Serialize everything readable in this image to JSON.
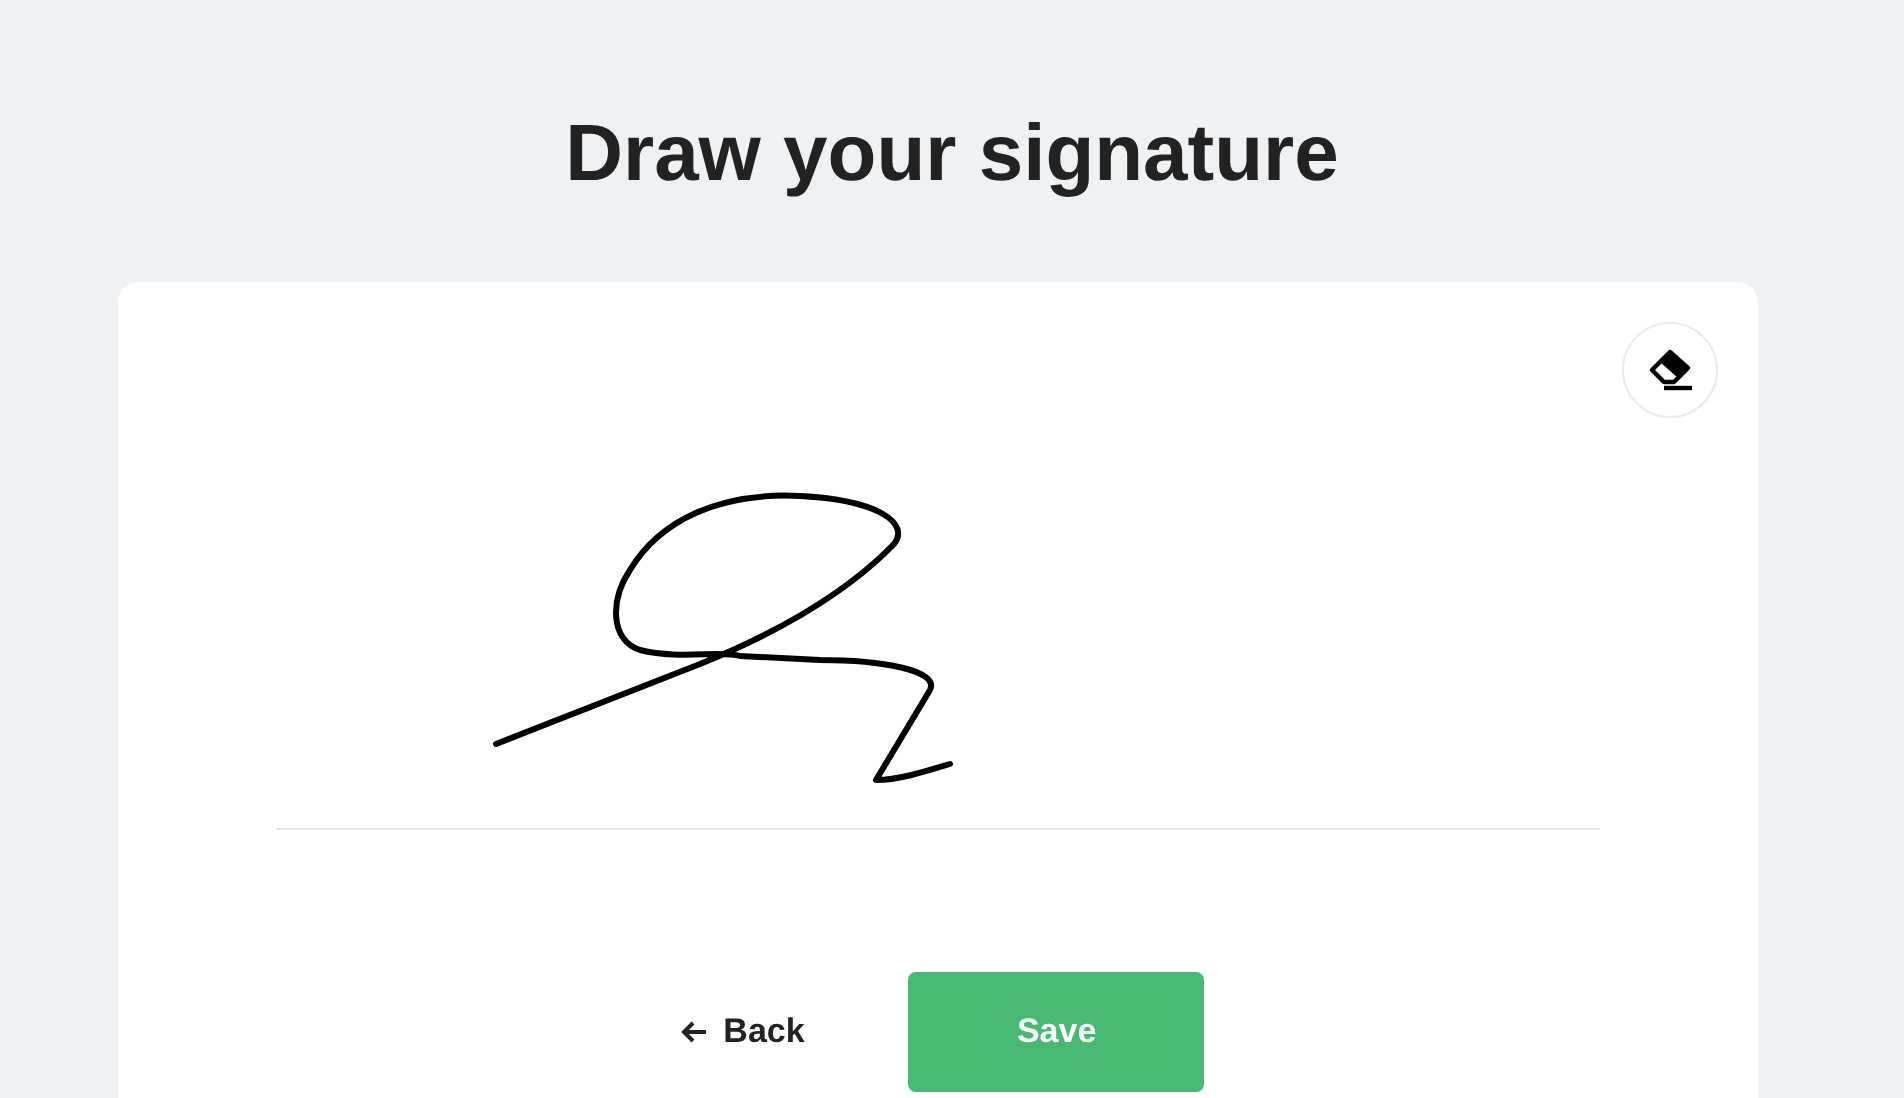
{
  "title": "Draw your signature",
  "buttons": [
    {
      "kind": "back",
      "label": "Back"
    },
    {
      "kind": "save",
      "label": "Save"
    }
  ]
}
